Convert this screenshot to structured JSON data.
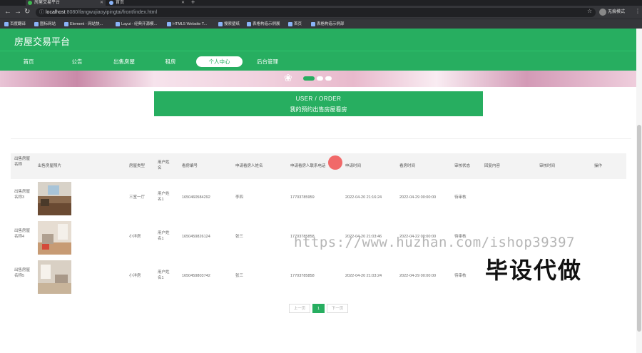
{
  "browser": {
    "tabs": [
      {
        "label": "房屋交易平台"
      },
      {
        "label": "首页"
      }
    ],
    "new_tab": "+",
    "url_host": "localhost",
    "url_path": ":8080/fangwujiaoyipingtai/front/index.html",
    "profile_label": "无痕模式",
    "bookmarks": [
      {
        "label": "百度翻译"
      },
      {
        "label": "图标网站"
      },
      {
        "label": "Element - 网站快..."
      },
      {
        "label": "Layui - 经典开源模..."
      },
      {
        "label": "HTML5 Website T..."
      },
      {
        "label": "搜索壁纸"
      },
      {
        "label": "表格构造示例展"
      },
      {
        "label": "首页"
      },
      {
        "label": "表格构造示例部"
      }
    ]
  },
  "site": {
    "title": "房屋交易平台",
    "nav": [
      "首页",
      "公告",
      "出售房屋",
      "租房",
      "个人中心",
      "后台管理"
    ],
    "active_nav_index": 4
  },
  "order_banner": {
    "line1": "USER / ORDER",
    "line2": "我的预约出售房屋看房"
  },
  "table": {
    "headers": [
      "出售房屋名称",
      "出售房屋照片",
      "房屋类型",
      "用户姓名",
      "看房编号",
      "申请看房人姓名",
      "申请看房人联系电话",
      "申请时间",
      "看房时间",
      "审核状态",
      "回复内容",
      "审核时间",
      "操作"
    ],
    "rows": [
      {
        "name": "出售房屋名称3",
        "type": "三室一厅",
        "user": "用户姓名1",
        "code": "1650460584292",
        "applicant": "李四",
        "phone": "17703785959",
        "apply_time": "2022-04-20 21:16:24",
        "view_time": "2022-04-29 00:00:00",
        "status": "待审核"
      },
      {
        "name": "出售房屋名称4",
        "type": "小洋房",
        "user": "用户姓名1",
        "code": "1650459826124",
        "applicant": "张三",
        "phone": "17703785858",
        "apply_time": "2022-04-20 21:03:46",
        "view_time": "2022-04-22 00:00:00",
        "status": "待审核"
      },
      {
        "name": "出售房屋名称5",
        "type": "小洋房",
        "user": "用户姓名1",
        "code": "1650459803742",
        "applicant": "张三",
        "phone": "17703785858",
        "apply_time": "2022-04-20 21:03:24",
        "view_time": "2022-04-29 00:00:00",
        "status": "待审核"
      }
    ]
  },
  "pagination": {
    "prev": "上一页",
    "current": "1",
    "next": "下一页"
  },
  "watermark": {
    "url": "https://www.huzhan.com/ishop39397",
    "text": "毕设代做"
  },
  "colors": {
    "brand": "#27ae60",
    "chrome": "#35363a"
  }
}
